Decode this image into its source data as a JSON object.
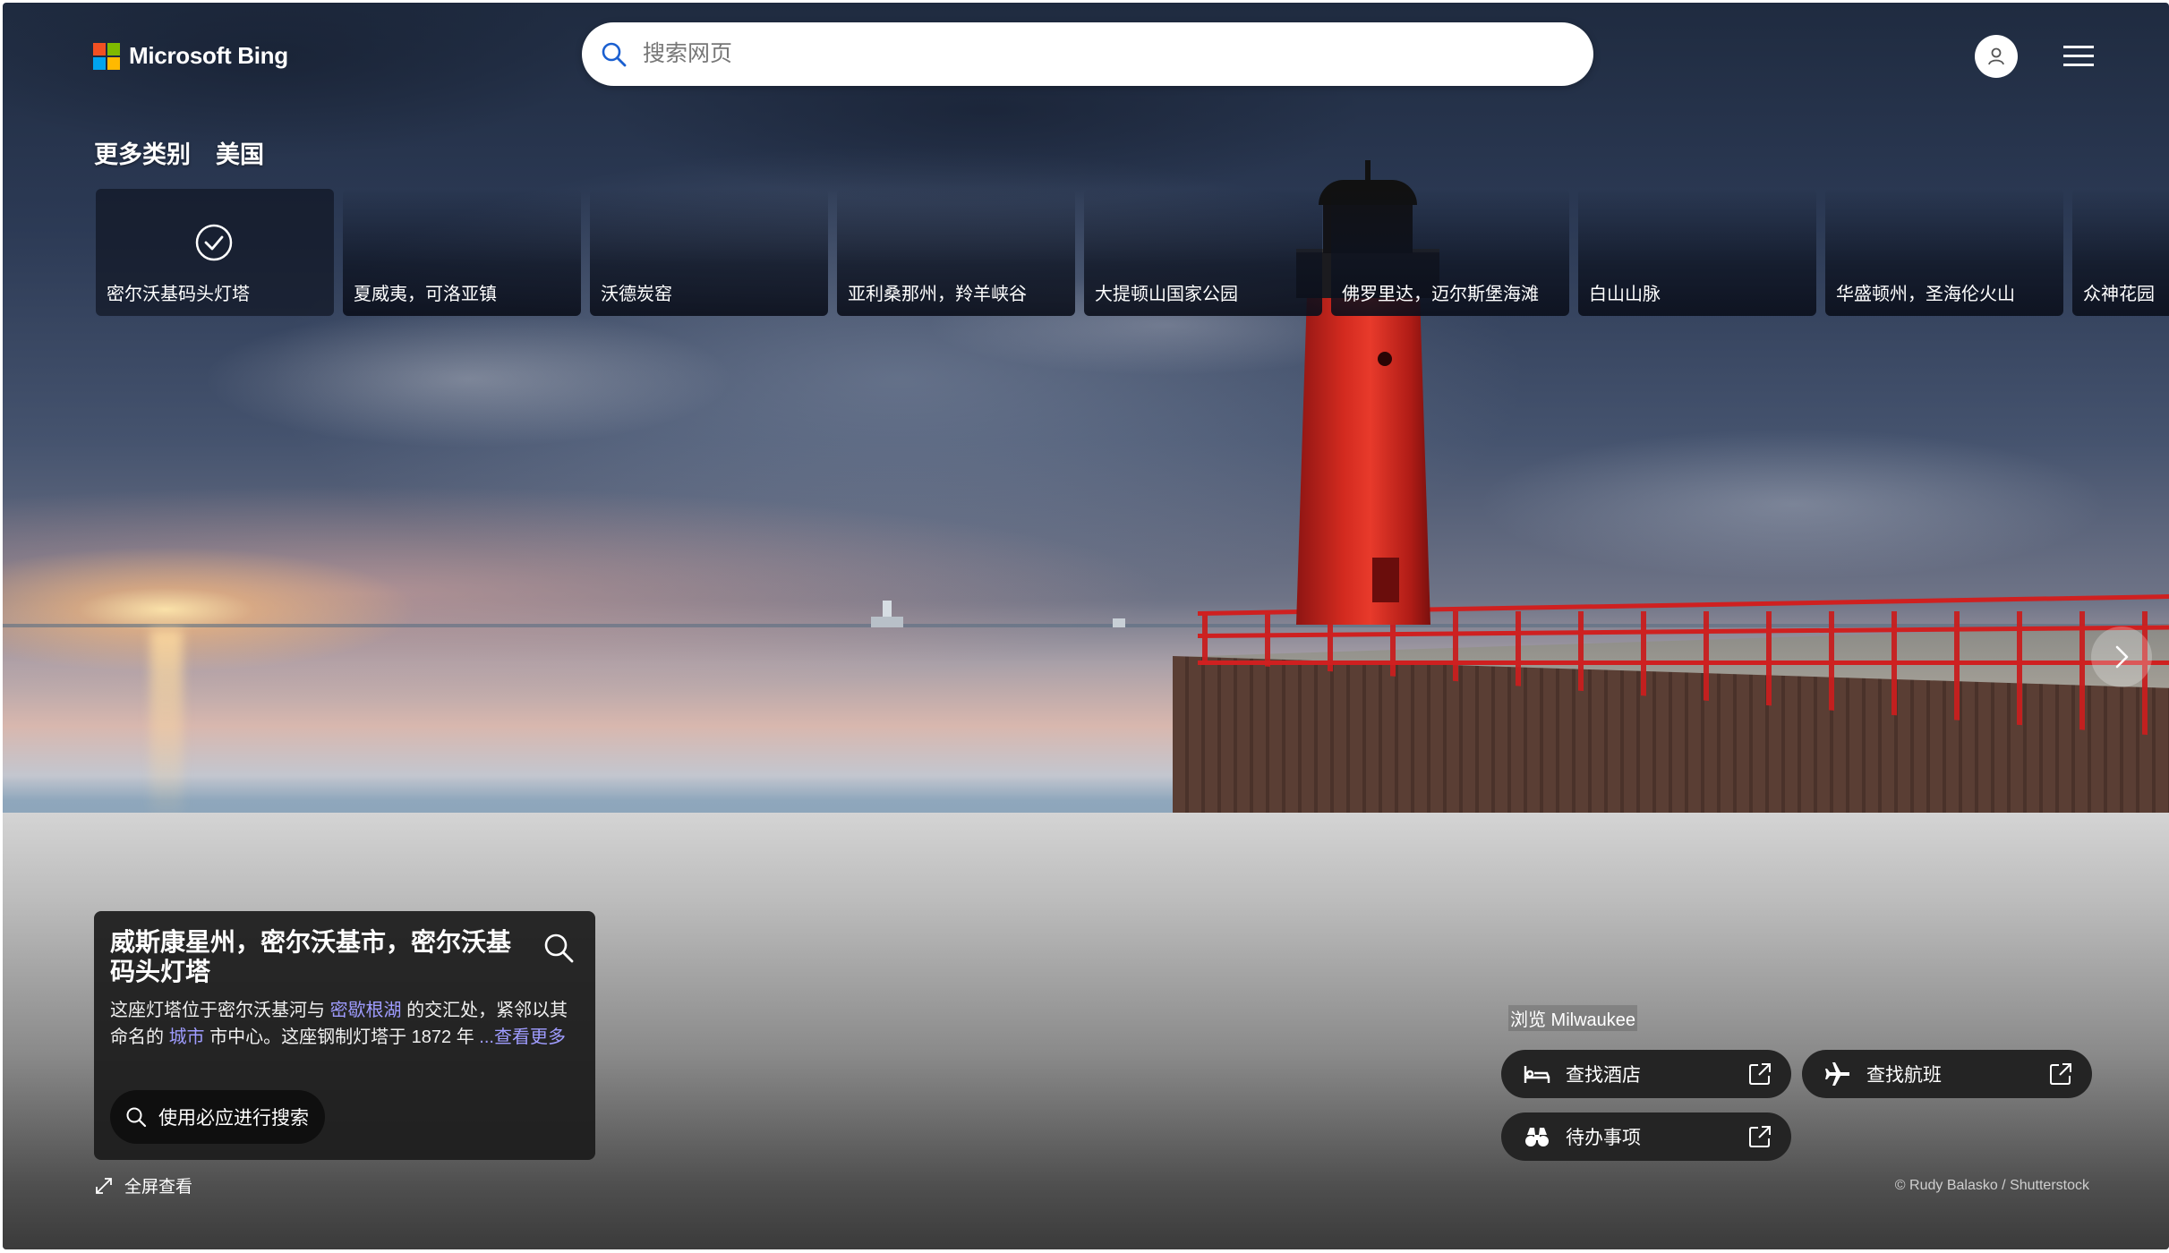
{
  "brand": {
    "name": "Microsoft Bing"
  },
  "search": {
    "placeholder": "搜索网页"
  },
  "categories": {
    "more_label": "更多类别",
    "region_label": "美国",
    "tiles": [
      {
        "label": "密尔沃基码头灯塔",
        "selected": true
      },
      {
        "label": "夏威夷，可洛亚镇"
      },
      {
        "label": "沃德炭窑"
      },
      {
        "label": "亚利桑那州，羚羊峡谷"
      },
      {
        "label": "大提顿山国家公园"
      },
      {
        "label": "佛罗里达，迈尔斯堡海滩"
      },
      {
        "label": "白山山脉"
      },
      {
        "label": "华盛顿州，圣海伦火山"
      },
      {
        "label": "众神花园"
      }
    ]
  },
  "info": {
    "title": "威斯康星州，密尔沃基市，密尔沃基码头灯塔",
    "desc_part1": "这座灯塔位于密尔沃基河与",
    "desc_link1": "密歇根湖",
    "desc_part2": "的交汇处，紧邻以其命名的",
    "desc_link2": "城市",
    "desc_part3": "市中心。这座钢制灯塔于 1872 年",
    "desc_more": "...查看更多",
    "search_button": "使用必应进行搜索"
  },
  "fullscreen_label": "全屏查看",
  "explore": {
    "title": "浏览 Milwaukee",
    "hotels": "查找酒店",
    "flights": "查找航班",
    "todo": "待办事项"
  },
  "credit": "© Rudy Balasko / Shutterstock",
  "colors": {
    "link": "#9f9cff",
    "card_bg": "#1c1c1c",
    "lighthouse_red": "#d22a1f"
  }
}
